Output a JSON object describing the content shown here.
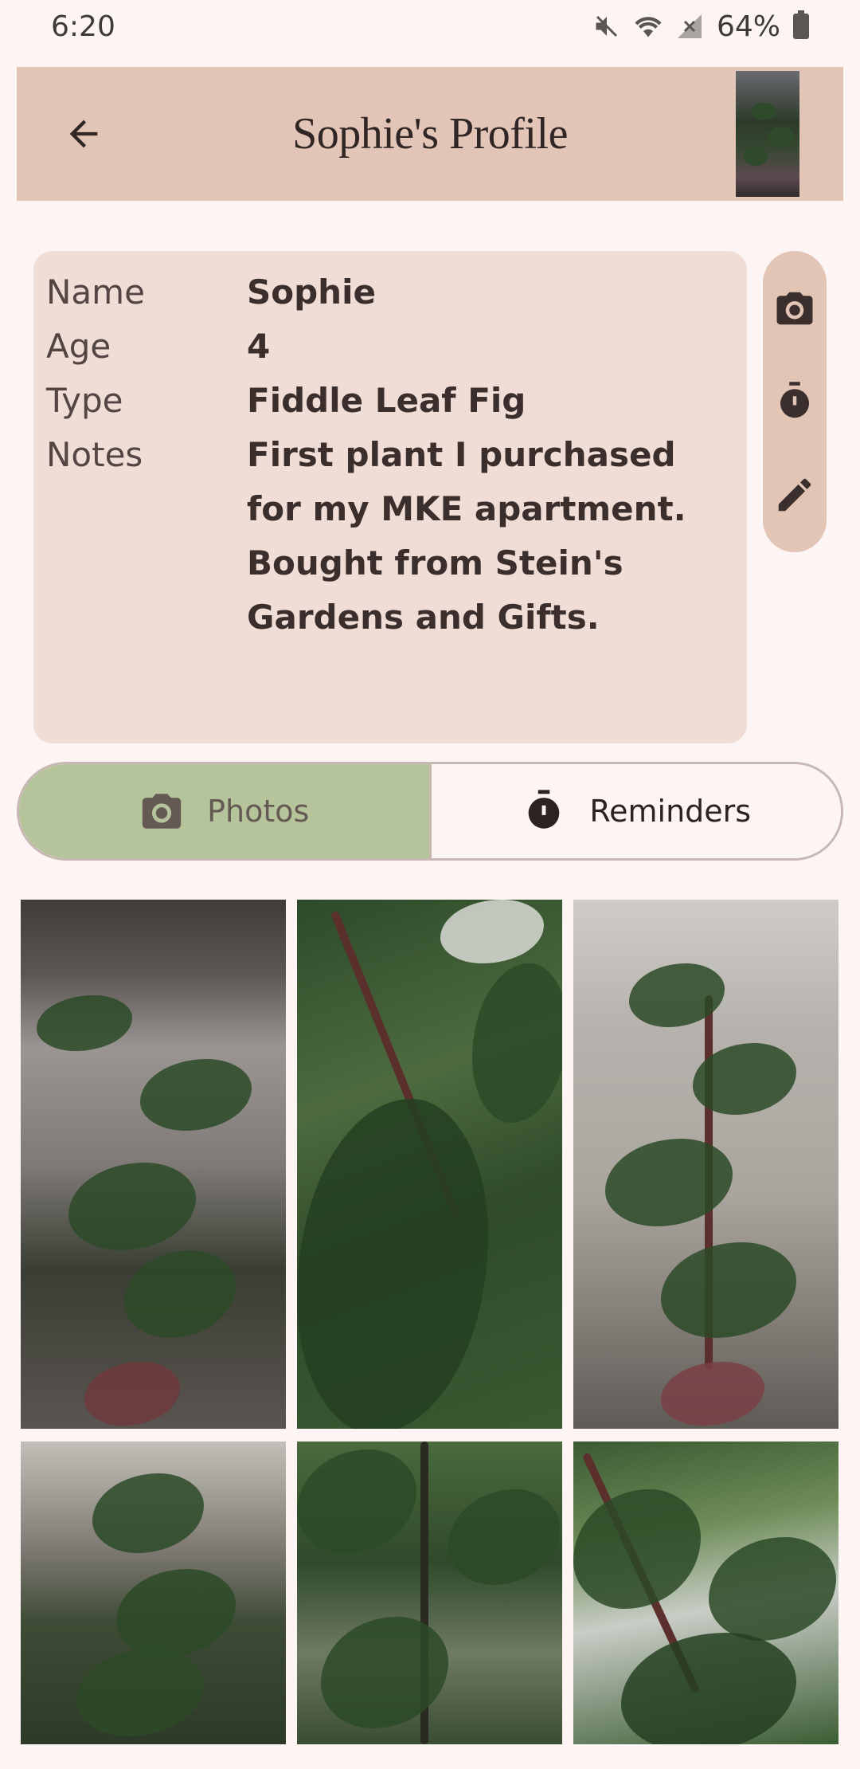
{
  "status": {
    "time": "6:20",
    "battery": "64%"
  },
  "app_bar": {
    "title": "Sophie's Profile"
  },
  "profile": {
    "rows": [
      {
        "label": "Name",
        "value": "Sophie"
      },
      {
        "label": "Age",
        "value": "4"
      },
      {
        "label": "Type",
        "value": "Fiddle Leaf Fig"
      },
      {
        "label": "Notes",
        "value": "First plant I purchased for my MKE apartment. Bought from Stein's Gardens and Gifts."
      }
    ]
  },
  "side_actions": {
    "icons": [
      "camera-icon",
      "timer-icon",
      "edit-icon"
    ]
  },
  "tabs": [
    {
      "label": "Photos",
      "icon": "camera-icon",
      "selected": true
    },
    {
      "label": "Reminders",
      "icon": "timer-icon",
      "selected": false
    }
  ],
  "colors": {
    "app_bar": "#e2c5b6",
    "card": "#f0ddd5",
    "tab_selected": "#b6c49b",
    "background": "#fcf5f4"
  }
}
